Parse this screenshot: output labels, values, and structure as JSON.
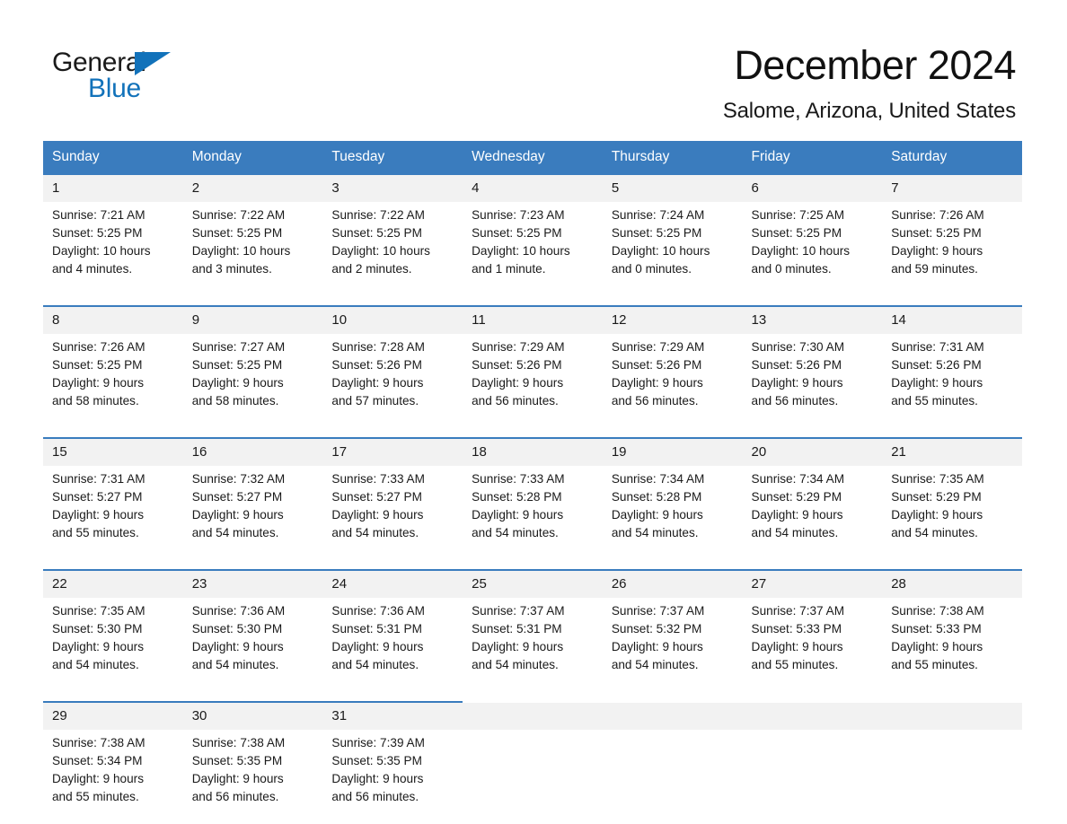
{
  "brand": {
    "name_part1": "General",
    "name_part2": "Blue",
    "accent_color": "#1272ba"
  },
  "header": {
    "title": "December 2024",
    "subtitle": "Salome, Arizona, United States"
  },
  "theme": {
    "header_row_color": "#3a7cbe",
    "daynum_bg": "#f2f2f2",
    "text_color": "#1a1a1a"
  },
  "weekday_headers": [
    "Sunday",
    "Monday",
    "Tuesday",
    "Wednesday",
    "Thursday",
    "Friday",
    "Saturday"
  ],
  "weeks": [
    {
      "days": [
        {
          "num": "1",
          "sunrise": "Sunrise: 7:21 AM",
          "sunset": "Sunset: 5:25 PM",
          "daylight1": "Daylight: 10 hours",
          "daylight2": "and 4 minutes."
        },
        {
          "num": "2",
          "sunrise": "Sunrise: 7:22 AM",
          "sunset": "Sunset: 5:25 PM",
          "daylight1": "Daylight: 10 hours",
          "daylight2": "and 3 minutes."
        },
        {
          "num": "3",
          "sunrise": "Sunrise: 7:22 AM",
          "sunset": "Sunset: 5:25 PM",
          "daylight1": "Daylight: 10 hours",
          "daylight2": "and 2 minutes."
        },
        {
          "num": "4",
          "sunrise": "Sunrise: 7:23 AM",
          "sunset": "Sunset: 5:25 PM",
          "daylight1": "Daylight: 10 hours",
          "daylight2": "and 1 minute."
        },
        {
          "num": "5",
          "sunrise": "Sunrise: 7:24 AM",
          "sunset": "Sunset: 5:25 PM",
          "daylight1": "Daylight: 10 hours",
          "daylight2": "and 0 minutes."
        },
        {
          "num": "6",
          "sunrise": "Sunrise: 7:25 AM",
          "sunset": "Sunset: 5:25 PM",
          "daylight1": "Daylight: 10 hours",
          "daylight2": "and 0 minutes."
        },
        {
          "num": "7",
          "sunrise": "Sunrise: 7:26 AM",
          "sunset": "Sunset: 5:25 PM",
          "daylight1": "Daylight: 9 hours",
          "daylight2": "and 59 minutes."
        }
      ]
    },
    {
      "days": [
        {
          "num": "8",
          "sunrise": "Sunrise: 7:26 AM",
          "sunset": "Sunset: 5:25 PM",
          "daylight1": "Daylight: 9 hours",
          "daylight2": "and 58 minutes."
        },
        {
          "num": "9",
          "sunrise": "Sunrise: 7:27 AM",
          "sunset": "Sunset: 5:25 PM",
          "daylight1": "Daylight: 9 hours",
          "daylight2": "and 58 minutes."
        },
        {
          "num": "10",
          "sunrise": "Sunrise: 7:28 AM",
          "sunset": "Sunset: 5:26 PM",
          "daylight1": "Daylight: 9 hours",
          "daylight2": "and 57 minutes."
        },
        {
          "num": "11",
          "sunrise": "Sunrise: 7:29 AM",
          "sunset": "Sunset: 5:26 PM",
          "daylight1": "Daylight: 9 hours",
          "daylight2": "and 56 minutes."
        },
        {
          "num": "12",
          "sunrise": "Sunrise: 7:29 AM",
          "sunset": "Sunset: 5:26 PM",
          "daylight1": "Daylight: 9 hours",
          "daylight2": "and 56 minutes."
        },
        {
          "num": "13",
          "sunrise": "Sunrise: 7:30 AM",
          "sunset": "Sunset: 5:26 PM",
          "daylight1": "Daylight: 9 hours",
          "daylight2": "and 56 minutes."
        },
        {
          "num": "14",
          "sunrise": "Sunrise: 7:31 AM",
          "sunset": "Sunset: 5:26 PM",
          "daylight1": "Daylight: 9 hours",
          "daylight2": "and 55 minutes."
        }
      ]
    },
    {
      "days": [
        {
          "num": "15",
          "sunrise": "Sunrise: 7:31 AM",
          "sunset": "Sunset: 5:27 PM",
          "daylight1": "Daylight: 9 hours",
          "daylight2": "and 55 minutes."
        },
        {
          "num": "16",
          "sunrise": "Sunrise: 7:32 AM",
          "sunset": "Sunset: 5:27 PM",
          "daylight1": "Daylight: 9 hours",
          "daylight2": "and 54 minutes."
        },
        {
          "num": "17",
          "sunrise": "Sunrise: 7:33 AM",
          "sunset": "Sunset: 5:27 PM",
          "daylight1": "Daylight: 9 hours",
          "daylight2": "and 54 minutes."
        },
        {
          "num": "18",
          "sunrise": "Sunrise: 7:33 AM",
          "sunset": "Sunset: 5:28 PM",
          "daylight1": "Daylight: 9 hours",
          "daylight2": "and 54 minutes."
        },
        {
          "num": "19",
          "sunrise": "Sunrise: 7:34 AM",
          "sunset": "Sunset: 5:28 PM",
          "daylight1": "Daylight: 9 hours",
          "daylight2": "and 54 minutes."
        },
        {
          "num": "20",
          "sunrise": "Sunrise: 7:34 AM",
          "sunset": "Sunset: 5:29 PM",
          "daylight1": "Daylight: 9 hours",
          "daylight2": "and 54 minutes."
        },
        {
          "num": "21",
          "sunrise": "Sunrise: 7:35 AM",
          "sunset": "Sunset: 5:29 PM",
          "daylight1": "Daylight: 9 hours",
          "daylight2": "and 54 minutes."
        }
      ]
    },
    {
      "days": [
        {
          "num": "22",
          "sunrise": "Sunrise: 7:35 AM",
          "sunset": "Sunset: 5:30 PM",
          "daylight1": "Daylight: 9 hours",
          "daylight2": "and 54 minutes."
        },
        {
          "num": "23",
          "sunrise": "Sunrise: 7:36 AM",
          "sunset": "Sunset: 5:30 PM",
          "daylight1": "Daylight: 9 hours",
          "daylight2": "and 54 minutes."
        },
        {
          "num": "24",
          "sunrise": "Sunrise: 7:36 AM",
          "sunset": "Sunset: 5:31 PM",
          "daylight1": "Daylight: 9 hours",
          "daylight2": "and 54 minutes."
        },
        {
          "num": "25",
          "sunrise": "Sunrise: 7:37 AM",
          "sunset": "Sunset: 5:31 PM",
          "daylight1": "Daylight: 9 hours",
          "daylight2": "and 54 minutes."
        },
        {
          "num": "26",
          "sunrise": "Sunrise: 7:37 AM",
          "sunset": "Sunset: 5:32 PM",
          "daylight1": "Daylight: 9 hours",
          "daylight2": "and 54 minutes."
        },
        {
          "num": "27",
          "sunrise": "Sunrise: 7:37 AM",
          "sunset": "Sunset: 5:33 PM",
          "daylight1": "Daylight: 9 hours",
          "daylight2": "and 55 minutes."
        },
        {
          "num": "28",
          "sunrise": "Sunrise: 7:38 AM",
          "sunset": "Sunset: 5:33 PM",
          "daylight1": "Daylight: 9 hours",
          "daylight2": "and 55 minutes."
        }
      ]
    },
    {
      "days": [
        {
          "num": "29",
          "sunrise": "Sunrise: 7:38 AM",
          "sunset": "Sunset: 5:34 PM",
          "daylight1": "Daylight: 9 hours",
          "daylight2": "and 55 minutes."
        },
        {
          "num": "30",
          "sunrise": "Sunrise: 7:38 AM",
          "sunset": "Sunset: 5:35 PM",
          "daylight1": "Daylight: 9 hours",
          "daylight2": "and 56 minutes."
        },
        {
          "num": "31",
          "sunrise": "Sunrise: 7:39 AM",
          "sunset": "Sunset: 5:35 PM",
          "daylight1": "Daylight: 9 hours",
          "daylight2": "and 56 minutes."
        },
        {
          "num": "",
          "sunrise": "",
          "sunset": "",
          "daylight1": "",
          "daylight2": "",
          "empty": true
        },
        {
          "num": "",
          "sunrise": "",
          "sunset": "",
          "daylight1": "",
          "daylight2": "",
          "empty": true
        },
        {
          "num": "",
          "sunrise": "",
          "sunset": "",
          "daylight1": "",
          "daylight2": "",
          "empty": true
        },
        {
          "num": "",
          "sunrise": "",
          "sunset": "",
          "daylight1": "",
          "daylight2": "",
          "empty": true
        }
      ]
    }
  ]
}
